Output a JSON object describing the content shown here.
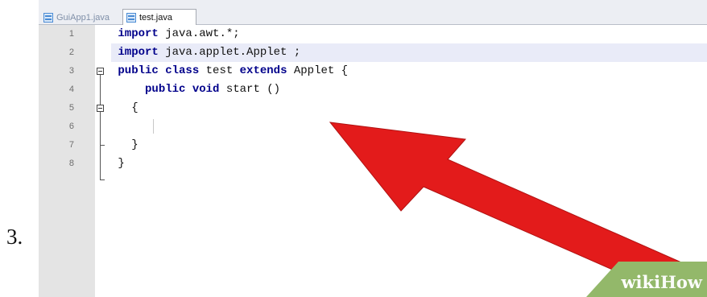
{
  "step": {
    "label": "3."
  },
  "tabs": [
    {
      "label": "GuiApp1.java",
      "active": false
    },
    {
      "label": "test.java",
      "active": true
    }
  ],
  "editor": {
    "highlighted_line": 2,
    "lines": [
      {
        "num": "1",
        "tokens": [
          {
            "t": "import",
            "k": "kw"
          },
          {
            "t": " java.awt.*;",
            "k": "cm"
          }
        ]
      },
      {
        "num": "2",
        "tokens": [
          {
            "t": "import",
            "k": "kw"
          },
          {
            "t": " java.applet.Applet ;",
            "k": "cm"
          }
        ]
      },
      {
        "num": "3",
        "tokens": [
          {
            "t": "public class",
            "k": "kw"
          },
          {
            "t": " test ",
            "k": "cm"
          },
          {
            "t": "extends",
            "k": "kw"
          },
          {
            "t": " Applet {",
            "k": "cm"
          }
        ]
      },
      {
        "num": "4",
        "tokens": [
          {
            "t": "    public void",
            "k": "kw"
          },
          {
            "t": " start ()",
            "k": "cm"
          }
        ]
      },
      {
        "num": "5",
        "tokens": [
          {
            "t": "  {",
            "k": "cm"
          }
        ]
      },
      {
        "num": "6",
        "tokens": [
          {
            "t": "",
            "k": "cm"
          }
        ]
      },
      {
        "num": "7",
        "tokens": [
          {
            "t": "  }",
            "k": "cm"
          }
        ]
      },
      {
        "num": "8",
        "tokens": [
          {
            "t": "}",
            "k": "cm"
          }
        ]
      }
    ]
  },
  "annotation": {
    "type": "red-arrow",
    "points_to": "start ()",
    "color": "#e31b1b"
  },
  "watermark": {
    "part1": "wiki",
    "part2": "How",
    "bg": "#93b86a"
  },
  "colors": {
    "keyword": "#00008b",
    "line_highlight": "#e9ebf8",
    "gutter": "#e4e4e4"
  }
}
